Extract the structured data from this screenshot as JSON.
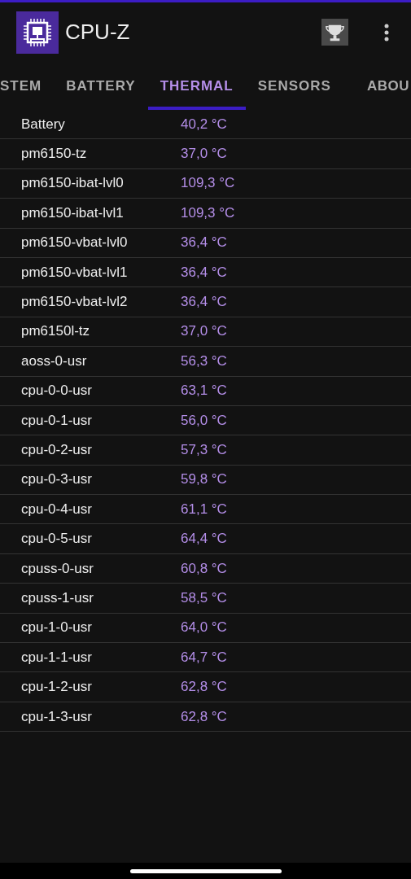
{
  "app_bar": {
    "title": "CPU-Z"
  },
  "tabs": [
    {
      "label": "STEM",
      "selected": false
    },
    {
      "label": "BATTERY",
      "selected": false
    },
    {
      "label": "THERMAL",
      "selected": true
    },
    {
      "label": "SENSORS",
      "selected": false
    },
    {
      "label": "ABOU",
      "selected": false
    }
  ],
  "rows": [
    {
      "name": "Battery",
      "value": "40,2 °C"
    },
    {
      "name": "pm6150-tz",
      "value": "37,0 °C"
    },
    {
      "name": "pm6150-ibat-lvl0",
      "value": "109,3 °C"
    },
    {
      "name": "pm6150-ibat-lvl1",
      "value": "109,3 °C"
    },
    {
      "name": "pm6150-vbat-lvl0",
      "value": "36,4 °C"
    },
    {
      "name": "pm6150-vbat-lvl1",
      "value": "36,4 °C"
    },
    {
      "name": "pm6150-vbat-lvl2",
      "value": "36,4 °C"
    },
    {
      "name": "pm6150l-tz",
      "value": "37,0 °C"
    },
    {
      "name": "aoss-0-usr",
      "value": "56,3 °C"
    },
    {
      "name": "cpu-0-0-usr",
      "value": "63,1 °C"
    },
    {
      "name": "cpu-0-1-usr",
      "value": "56,0 °C"
    },
    {
      "name": "cpu-0-2-usr",
      "value": "57,3 °C"
    },
    {
      "name": "cpu-0-3-usr",
      "value": "59,8 °C"
    },
    {
      "name": "cpu-0-4-usr",
      "value": "61,1 °C"
    },
    {
      "name": "cpu-0-5-usr",
      "value": "64,4 °C"
    },
    {
      "name": "cpuss-0-usr",
      "value": "60,8 °C"
    },
    {
      "name": "cpuss-1-usr",
      "value": "58,5 °C"
    },
    {
      "name": "cpu-1-0-usr",
      "value": "64,0 °C"
    },
    {
      "name": "cpu-1-1-usr",
      "value": "64,7 °C"
    },
    {
      "name": "cpu-1-2-usr",
      "value": "62,8 °C"
    },
    {
      "name": "cpu-1-3-usr",
      "value": "62,8 °C"
    }
  ]
}
